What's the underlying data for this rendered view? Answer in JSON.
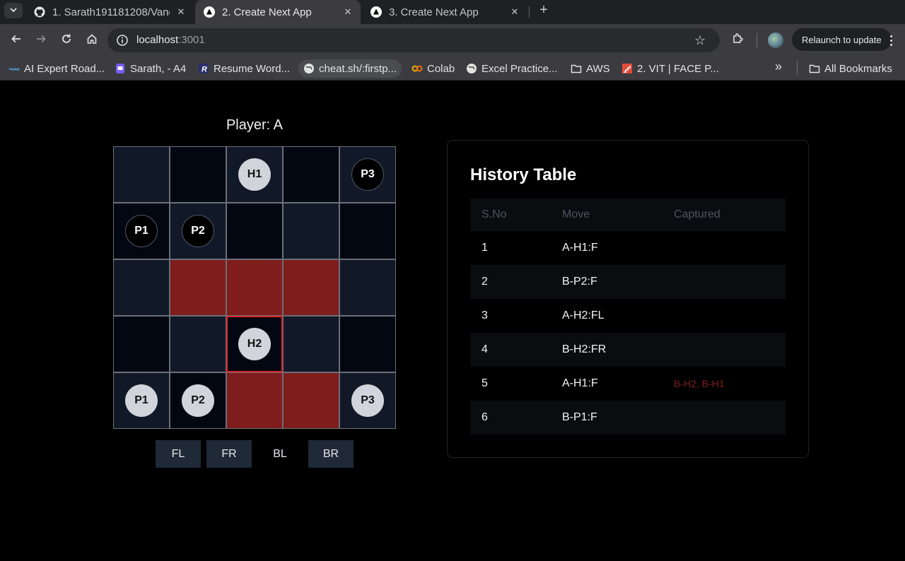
{
  "tabs": [
    {
      "title": "1. Sarath191181208/Vanq",
      "icon": "github-icon",
      "active": false
    },
    {
      "title": "2. Create Next App",
      "icon": "nextjs-icon",
      "active": true
    },
    {
      "title": "3. Create Next App",
      "icon": "nextjs-icon",
      "active": false
    }
  ],
  "address_bar": {
    "host": "localhost",
    "port": ":3001"
  },
  "relaunch_label": "Relaunch to update",
  "bookmarks": [
    "AI Expert Road...",
    "Sarath, - A4",
    "Resume Word...",
    "cheat.sh/:firstp...",
    "Colab",
    "Excel Practice...",
    "AWS",
    "2. VIT | FACE P...",
    "All Bookmarks"
  ],
  "game": {
    "player_label": "Player: A",
    "board": [
      [
        {
          "t": "light",
          "p": ""
        },
        {
          "t": "dark",
          "p": ""
        },
        {
          "t": "light",
          "p": "H1",
          "c": "white"
        },
        {
          "t": "dark",
          "p": ""
        },
        {
          "t": "light",
          "p": "P3",
          "c": "black"
        }
      ],
      [
        {
          "t": "dark",
          "p": "P1",
          "c": "black"
        },
        {
          "t": "light",
          "p": "P2",
          "c": "black"
        },
        {
          "t": "dark",
          "p": ""
        },
        {
          "t": "light",
          "p": ""
        },
        {
          "t": "dark",
          "p": ""
        }
      ],
      [
        {
          "t": "light",
          "p": ""
        },
        {
          "t": "red",
          "p": ""
        },
        {
          "t": "red",
          "p": ""
        },
        {
          "t": "red",
          "p": ""
        },
        {
          "t": "light",
          "p": ""
        }
      ],
      [
        {
          "t": "dark",
          "p": ""
        },
        {
          "t": "light",
          "p": ""
        },
        {
          "t": "sel",
          "p": "H2",
          "c": "white"
        },
        {
          "t": "light",
          "p": ""
        },
        {
          "t": "dark",
          "p": ""
        }
      ],
      [
        {
          "t": "light",
          "p": "P1",
          "c": "white"
        },
        {
          "t": "dark",
          "p": "P2",
          "c": "white"
        },
        {
          "t": "red",
          "p": ""
        },
        {
          "t": "red",
          "p": ""
        },
        {
          "t": "light",
          "p": "P3",
          "c": "white"
        }
      ]
    ],
    "move_buttons": [
      {
        "label": "FL",
        "enabled": true
      },
      {
        "label": "FR",
        "enabled": true
      },
      {
        "label": "BL",
        "enabled": false
      },
      {
        "label": "BR",
        "enabled": true
      }
    ]
  },
  "history": {
    "title": "History Table",
    "headers": [
      "S.No",
      "Move",
      "Captured"
    ],
    "rows": [
      {
        "sno": "1",
        "move": "A-H1:F",
        "captured": ""
      },
      {
        "sno": "2",
        "move": "B-P2:F",
        "captured": ""
      },
      {
        "sno": "3",
        "move": "A-H2:FL",
        "captured": ""
      },
      {
        "sno": "4",
        "move": "B-H2:FR",
        "captured": ""
      },
      {
        "sno": "5",
        "move": "A-H1:F",
        "captured": "B-H2, B-H1"
      },
      {
        "sno": "6",
        "move": "B-P1:F",
        "captured": ""
      }
    ]
  },
  "colors": {
    "captured_text": "#7f1d1d",
    "highlight_cell": "#7f1d1d",
    "selected_border": "#dc2626"
  }
}
